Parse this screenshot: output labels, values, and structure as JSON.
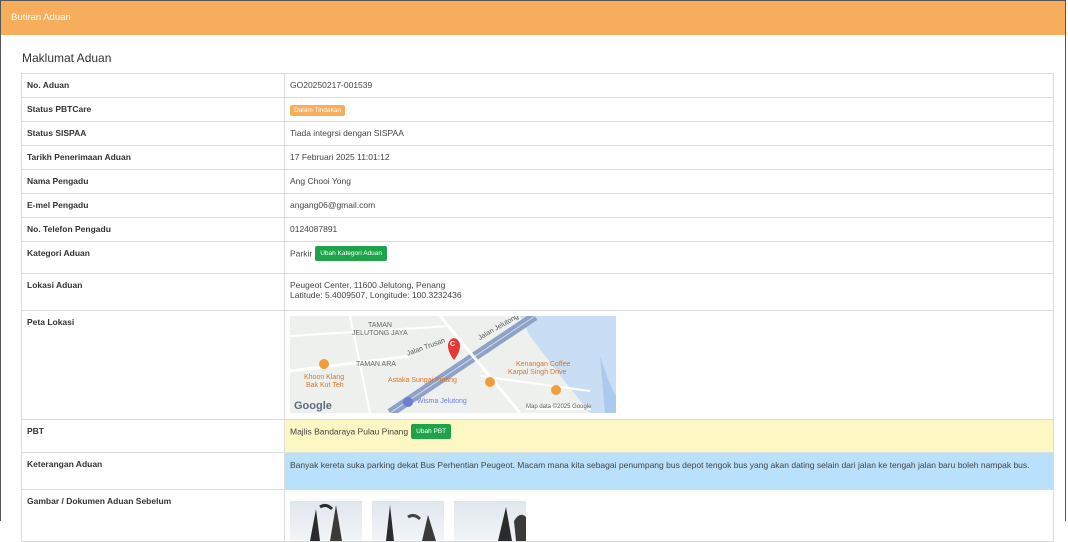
{
  "header": {
    "title": "Butiran Aduan"
  },
  "section_title": "Maklumat Aduan",
  "rows": {
    "no_aduan": {
      "label": "No. Aduan",
      "value": "GO20250217-001539"
    },
    "status_pbtcare": {
      "label": "Status PBTCare",
      "badge": "Dalam Tindakan",
      "badge_color": "#f6ad5c"
    },
    "status_sispaa": {
      "label": "Status SISPAA",
      "value": "Tiada integrsi dengan SISPAA"
    },
    "tarikh": {
      "label": "Tarikh Penerimaan Aduan",
      "value": "17 Februari 2025 11:01:12"
    },
    "nama": {
      "label": "Nama Pengadu",
      "value": "Ang Chooi Yong"
    },
    "emel": {
      "label": "E-mel Pengadu",
      "value": "angang06@gmail.com"
    },
    "telefon": {
      "label": "No. Telefon Pengadu",
      "value": "0124087891"
    },
    "kategori": {
      "label": "Kategori Aduan",
      "value": "Parkir",
      "button": "Ubah Kategori Aduan"
    },
    "lokasi": {
      "label": "Lokasi Aduan",
      "address": "Peugeot Center, 11600 Jelutong, Penang",
      "coords": "Latitude: 5.4009507, Longitude: 100.3232436"
    },
    "peta": {
      "label": "Peta Lokasi",
      "map_labels": {
        "taman_jelutong": "TAMAN",
        "taman_jelutong2": "JELUTONG JAYA",
        "jalan_trusan": "Jalan Trusan",
        "jalan_jelutong": "Jalan Jelutong",
        "taman_ara": "TAMAN ARA",
        "khoon_klang": "Khoon Klang",
        "khoon_klang2": "Bak Kut Teh",
        "astaka": "Astaka Sungai Pinang",
        "kenangan": "Kenangan Coffee",
        "karpal": "Karpal Singh Drive",
        "wisma": "Wisma Jelutong",
        "google": "Google",
        "map_data": "Map data ©2025 Google"
      },
      "pin_letter": "C"
    },
    "pbt": {
      "label": "PBT",
      "value": "Majlis Bandaraya Pulau Pinang",
      "button": "Ubah PBT"
    },
    "keterangan": {
      "label": "Keterangan Aduan",
      "value": "Banyak kereta suka parking dekat Bus Perhentian Peugeot. Macam mana kita sebagai penumpang bus depot tengok bus yang akan dating selain dari jalan ke tengah jalan baru boleh nampak bus."
    },
    "gambar": {
      "label": "Gambar / Dokumen Aduan Sebelum"
    }
  },
  "colors": {
    "header": "#f6ad5c",
    "button_green": "#1fa34a",
    "pbt_bg": "#fdf7c3",
    "keterangan_bg": "#b9e1fb"
  }
}
